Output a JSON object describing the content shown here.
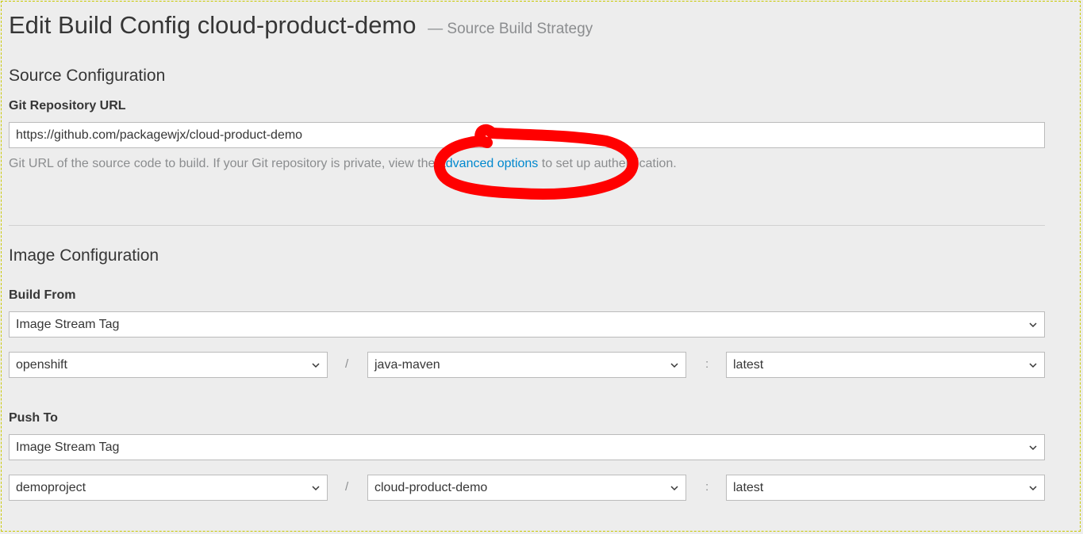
{
  "header": {
    "title": "Edit Build Config cloud-product-demo",
    "subtitle": "— Source Build Strategy"
  },
  "source": {
    "section_title": "Source Configuration",
    "git_label": "Git Repository URL",
    "git_url": "https://github.com/packagewjx/cloud-product-demo",
    "help_before": "Git URL of the source code to build. If your Git repository is private, view the ",
    "help_link": "advanced options",
    "help_after": " to set up authentication."
  },
  "image": {
    "section_title": "Image Configuration",
    "build_from": {
      "label": "Build From",
      "kind": "Image Stream Tag",
      "namespace": "openshift",
      "image_stream": "java-maven",
      "tag": "latest"
    },
    "push_to": {
      "label": "Push To",
      "kind": "Image Stream Tag",
      "namespace": "demoproject",
      "image_stream": "cloud-product-demo",
      "tag": "latest"
    },
    "slash": "/",
    "colon": ":"
  },
  "icons": {
    "select_caret": "chevron-down-icon",
    "annotation": "red-circle-annotation"
  },
  "colors": {
    "link": "#0088ce",
    "annotation": "#ff0000",
    "background": "#ededed"
  }
}
